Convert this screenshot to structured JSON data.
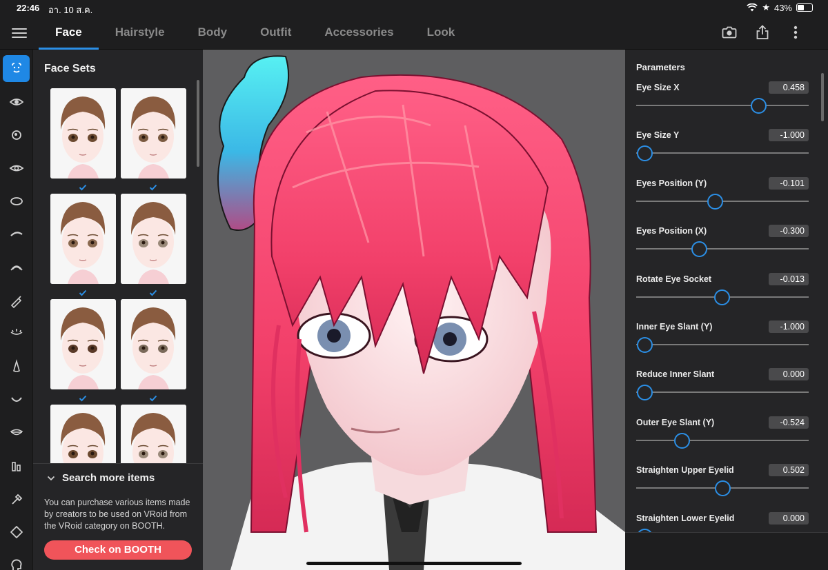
{
  "status": {
    "time": "22:46",
    "date": "อา. 10 ส.ค.",
    "battery": "43%"
  },
  "tabs": [
    {
      "label": "Face",
      "active": true
    },
    {
      "label": "Hairstyle",
      "active": false
    },
    {
      "label": "Body",
      "active": false
    },
    {
      "label": "Outfit",
      "active": false
    },
    {
      "label": "Accessories",
      "active": false
    },
    {
      "label": "Look",
      "active": false
    }
  ],
  "toolbar_icons": [
    "camera-icon",
    "share-icon",
    "more-vertical-icon"
  ],
  "rail_icons": [
    "face-icon",
    "eye-icon",
    "iris-icon",
    "eye-white-icon",
    "face-outline-icon",
    "eyebrow-icon",
    "eyelash-icon",
    "eyeliner-icon",
    "eye-line-icon",
    "nose-icon",
    "mouth-icon",
    "teeth-icon",
    "ear-icon",
    "brush-icon",
    "face-shape-icon",
    "head-icon"
  ],
  "face_sets": {
    "title": "Face Sets",
    "items": [
      {
        "checked": true
      },
      {
        "checked": true
      },
      {
        "checked": true
      },
      {
        "checked": true
      },
      {
        "checked": true
      },
      {
        "checked": true
      },
      {
        "checked": false
      },
      {
        "checked": false
      }
    ]
  },
  "search_more": {
    "header": "Search more items",
    "text": "You can purchase various items made by creators to be used on VRoid from the VRoid category on BOOTH.",
    "button": "Check on BOOTH"
  },
  "parameters": {
    "title": "Parameters",
    "items": [
      {
        "label": "Eye Size X",
        "value": "0.458",
        "level": 0.729
      },
      {
        "label": "Eye Size Y",
        "value": "-1.000",
        "level": 0.0
      },
      {
        "label": "Eyes Position (Y)",
        "value": "-0.101",
        "level": 0.45
      },
      {
        "label": "Eyes Position (X)",
        "value": "-0.300",
        "level": 0.35
      },
      {
        "label": "Rotate Eye Socket",
        "value": "-0.013",
        "level": 0.494
      },
      {
        "label": "Inner Eye Slant (Y)",
        "value": "-1.000",
        "level": 0.0
      },
      {
        "label": "Reduce Inner Slant",
        "value": "0.000",
        "level": 0.0
      },
      {
        "label": "Outer Eye Slant (Y)",
        "value": "-0.524",
        "level": 0.238
      },
      {
        "label": "Straighten Upper Eyelid",
        "value": "0.502",
        "level": 0.502
      },
      {
        "label": "Straighten Lower Eyelid",
        "value": "0.000",
        "level": 0.0
      }
    ]
  },
  "colors": {
    "accent": "#2b8fe6",
    "booth": "#f0545a",
    "panel": "#252527",
    "hair": "#f0486e"
  }
}
